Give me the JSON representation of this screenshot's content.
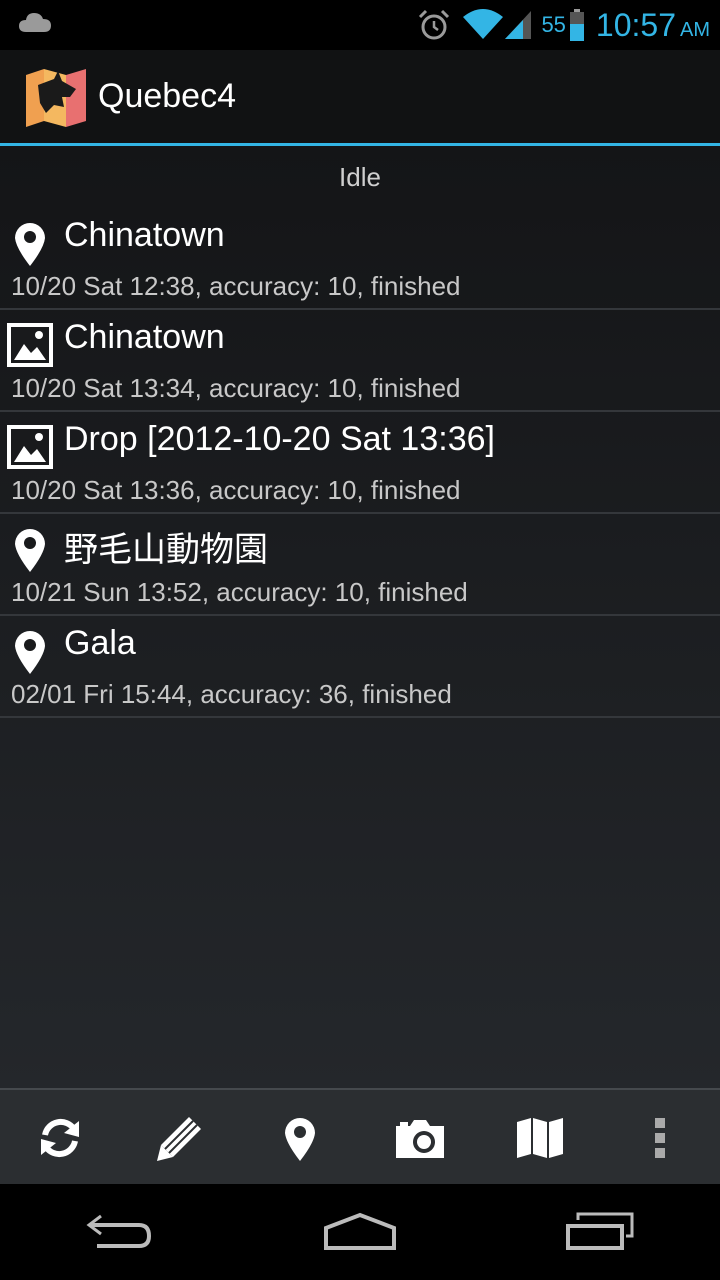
{
  "status_bar": {
    "battery_percent": "55",
    "time": "10:57",
    "ampm": "AM",
    "accent_color": "#33b5e5"
  },
  "action_bar": {
    "title": "Quebec4",
    "logo_icon": "quebec4-logo-icon"
  },
  "status_text": "Idle",
  "items": [
    {
      "icon": "map-pin-icon",
      "title": "Chinatown",
      "subtitle": "10/20 Sat 12:38, accuracy: 10, finished"
    },
    {
      "icon": "image-icon",
      "title": "Chinatown",
      "subtitle": "10/20 Sat 13:34, accuracy: 10, finished"
    },
    {
      "icon": "image-icon",
      "title": "Drop [2012-10-20 Sat 13:36]",
      "subtitle": "10/20 Sat 13:36, accuracy: 10, finished"
    },
    {
      "icon": "map-pin-icon",
      "title": "野毛山動物園",
      "subtitle": "10/21 Sun 13:52, accuracy: 10, finished"
    },
    {
      "icon": "map-pin-icon",
      "title": "Gala",
      "subtitle": "02/01 Fri 15:44, accuracy: 36, finished"
    }
  ],
  "bottom_actions": [
    "sync-icon",
    "pencil-icon",
    "map-pin-icon",
    "camera-icon",
    "map-icon",
    "overflow-menu-icon"
  ],
  "nav_buttons": [
    "back-icon",
    "home-icon",
    "recent-apps-icon"
  ]
}
